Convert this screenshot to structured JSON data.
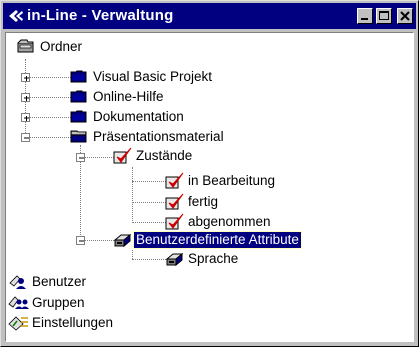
{
  "window": {
    "title": "in-Line - Verwaltung"
  },
  "tree": {
    "root": "Ordner",
    "items": [
      {
        "label": "Visual Basic Projekt"
      },
      {
        "label": "Online-Hilfe"
      },
      {
        "label": "Dokumentation"
      },
      {
        "label": "Präsentationsmaterial",
        "children": [
          {
            "label": "Zustände",
            "children": [
              {
                "label": "in Bearbeitung"
              },
              {
                "label": "fertig"
              },
              {
                "label": "abgenommen"
              }
            ]
          },
          {
            "label": "Benutzerdefinierte Attribute",
            "children": [
              {
                "label": "Sprache"
              }
            ]
          }
        ]
      }
    ]
  },
  "bottom": [
    {
      "label": "Benutzer"
    },
    {
      "label": "Gruppen"
    },
    {
      "label": "Einstellungen"
    }
  ],
  "colors": {
    "titlebar": "#000080",
    "selection": "#000080",
    "check": "#cc0000",
    "folder": "#000080"
  }
}
